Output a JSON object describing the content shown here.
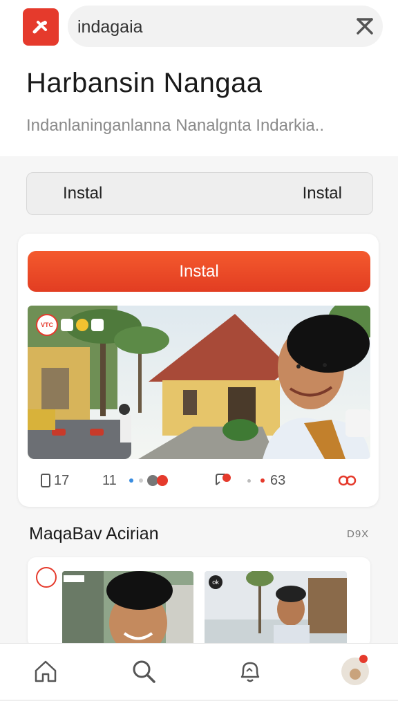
{
  "search": {
    "value": "indagaia"
  },
  "header": {
    "title": "Harbansin Nangaa",
    "subtitle": "Indanlaninganlanna Nanalgnta Indarkia.."
  },
  "install_row": {
    "left_label": "Instal",
    "right_label": "Instal"
  },
  "card": {
    "primary_button": "Instal",
    "photo_badge": "VTC",
    "stats": {
      "views": "17",
      "likes": "11",
      "shares": "63"
    }
  },
  "section": {
    "title": "MaqaBav Acirian",
    "more": "D9X"
  },
  "bottom_card": {
    "badge": "ok"
  },
  "colors": {
    "accent": "#e53a2c",
    "button_top": "#f45a2d",
    "button_bottom": "#e23d22"
  },
  "icons": {
    "app": "tools-icon",
    "clear": "clear-icon",
    "home": "home-icon",
    "search": "search-icon",
    "notifications": "bell-icon",
    "profile": "avatar"
  }
}
